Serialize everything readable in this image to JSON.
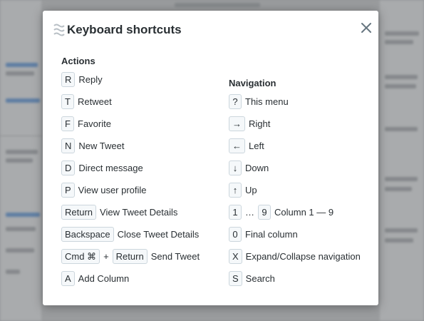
{
  "modal": {
    "title": "Keyboard shortcuts"
  },
  "actions": {
    "heading": "Actions",
    "items": [
      {
        "keys": [
          "R"
        ],
        "label": "Reply"
      },
      {
        "keys": [
          "T"
        ],
        "label": "Retweet"
      },
      {
        "keys": [
          "F"
        ],
        "label": "Favorite"
      },
      {
        "keys": [
          "N"
        ],
        "label": "New Tweet"
      },
      {
        "keys": [
          "D"
        ],
        "label": "Direct message"
      },
      {
        "keys": [
          "P"
        ],
        "label": "View user profile"
      },
      {
        "keys": [
          "Return"
        ],
        "label": "View Tweet Details"
      },
      {
        "keys": [
          "Backspace"
        ],
        "label": "Close Tweet Details"
      },
      {
        "keys": [
          "Cmd ⌘",
          "Return"
        ],
        "joiner": "+",
        "label": "Send Tweet"
      },
      {
        "keys": [
          "A"
        ],
        "label": "Add Column"
      }
    ]
  },
  "navigation": {
    "heading": "Navigation",
    "items": [
      {
        "keys": [
          "?"
        ],
        "label": "This menu"
      },
      {
        "keys": [
          "→"
        ],
        "label": "Right"
      },
      {
        "keys": [
          "←"
        ],
        "label": "Left"
      },
      {
        "keys": [
          "↓"
        ],
        "label": "Down"
      },
      {
        "keys": [
          "↑"
        ],
        "label": "Up"
      },
      {
        "keys": [
          "1",
          "9"
        ],
        "joiner": "…",
        "label": "Column 1 — 9"
      },
      {
        "keys": [
          "0"
        ],
        "label": "Final column"
      },
      {
        "keys": [
          "X"
        ],
        "label": "Expand/Collapse navigation"
      },
      {
        "keys": [
          "S"
        ],
        "label": "Search"
      }
    ]
  }
}
